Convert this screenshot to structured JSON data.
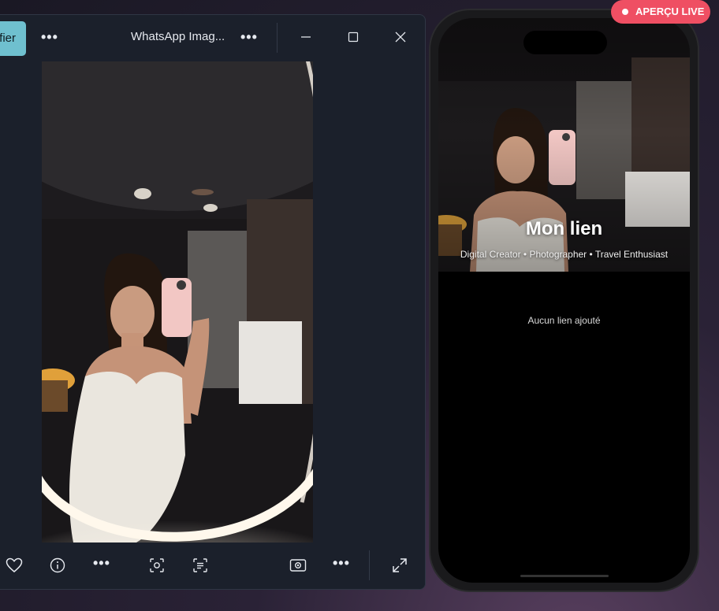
{
  "viewer": {
    "edit_button_label": "fier",
    "title": "WhatsApp Imag...",
    "more_left_label": "•••",
    "more_title_label": "•••",
    "more_toolbar_label": "•••",
    "more_toolbar_right_label": "•••"
  },
  "preview": {
    "badge_label": "APERÇU LIVE",
    "profile_name": "Mon lien",
    "profile_bio": "Digital Creator • Photographer • Travel Enthusiast",
    "empty_links_text": "Aucun lien ajouté"
  },
  "icons": {
    "minimize": "minimize-icon",
    "maximize": "maximize-icon",
    "close": "close-icon",
    "favorite": "heart-icon",
    "info": "info-icon",
    "visual_search": "visual-search-icon",
    "text_extract": "text-extract-icon",
    "slideshow": "slideshow-icon",
    "fullscreen": "fullscreen-icon"
  },
  "colors": {
    "accent": "#6fc0cf",
    "live_badge": "#ef4f63",
    "window_bg": "#1b202b"
  }
}
